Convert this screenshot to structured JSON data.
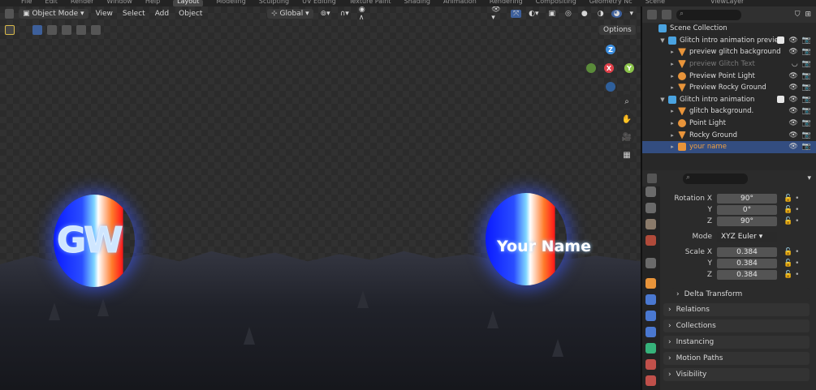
{
  "top_bar": {
    "menus": [
      "File",
      "Edit",
      "Render",
      "Window",
      "Help"
    ],
    "workspaces": [
      "Layout",
      "Modeling",
      "Sculpting",
      "UV Editing",
      "Texture Paint",
      "Shading",
      "Animation",
      "Rendering",
      "Compositing",
      "Geometry Nc"
    ],
    "scene": "Scene",
    "view_layer": "ViewLayer"
  },
  "viewport_header": {
    "mode": "Object Mode",
    "menus": [
      "View",
      "Select",
      "Add",
      "Object"
    ],
    "transform_orientation": "Global",
    "options_label": "Options"
  },
  "viewport": {
    "logo_text": "GW",
    "name_text": "Your Name",
    "gizmo": {
      "z": "Z",
      "y": "Y",
      "x": "X"
    }
  },
  "outliner": {
    "rows": [
      {
        "label": "Scene Collection",
        "indent": 0,
        "kind": "collection",
        "muted": false,
        "selected": false
      },
      {
        "label": "Glitch intro animation preview",
        "indent": 1,
        "kind": "collection",
        "muted": false,
        "selected": false
      },
      {
        "label": "preview glitch background",
        "indent": 2,
        "kind": "mesh",
        "muted": false,
        "selected": false
      },
      {
        "label": "preview Glitch Text",
        "indent": 2,
        "kind": "mesh",
        "muted": true,
        "selected": false
      },
      {
        "label": "Preview Point Light",
        "indent": 2,
        "kind": "light",
        "muted": false,
        "selected": false
      },
      {
        "label": "Preview Rocky Ground",
        "indent": 2,
        "kind": "mesh",
        "muted": false,
        "selected": false
      },
      {
        "label": "Glitch intro animation",
        "indent": 1,
        "kind": "collection",
        "muted": false,
        "selected": false
      },
      {
        "label": "glitch background.",
        "indent": 2,
        "kind": "mesh",
        "muted": false,
        "selected": false
      },
      {
        "label": "Point Light",
        "indent": 2,
        "kind": "light",
        "muted": false,
        "selected": false
      },
      {
        "label": "Rocky Ground",
        "indent": 2,
        "kind": "mesh",
        "muted": false,
        "selected": false
      },
      {
        "label": "your name",
        "indent": 2,
        "kind": "text",
        "muted": false,
        "selected": true
      }
    ]
  },
  "properties": {
    "rotation": {
      "label_x": "Rotation X",
      "label_y": "Y",
      "label_z": "Z",
      "x": "90°",
      "y": "0°",
      "z": "90°"
    },
    "mode": {
      "label": "Mode",
      "value": "XYZ Euler"
    },
    "scale": {
      "label_x": "Scale X",
      "label_y": "Y",
      "label_z": "Z",
      "x": "0.384",
      "y": "0.384",
      "z": "0.384"
    },
    "delta_transform": "Delta Transform",
    "panels": [
      "Relations",
      "Collections",
      "Instancing",
      "Motion Paths",
      "Visibility"
    ]
  },
  "colors": {
    "accent_selected": "#334d80",
    "gizmo_x": "#e0404a",
    "gizmo_y": "#8bc34a",
    "gizmo_z": "#3d8fe0",
    "mesh_icon": "#e8943a",
    "collection_icon": "#4aa3e0"
  }
}
